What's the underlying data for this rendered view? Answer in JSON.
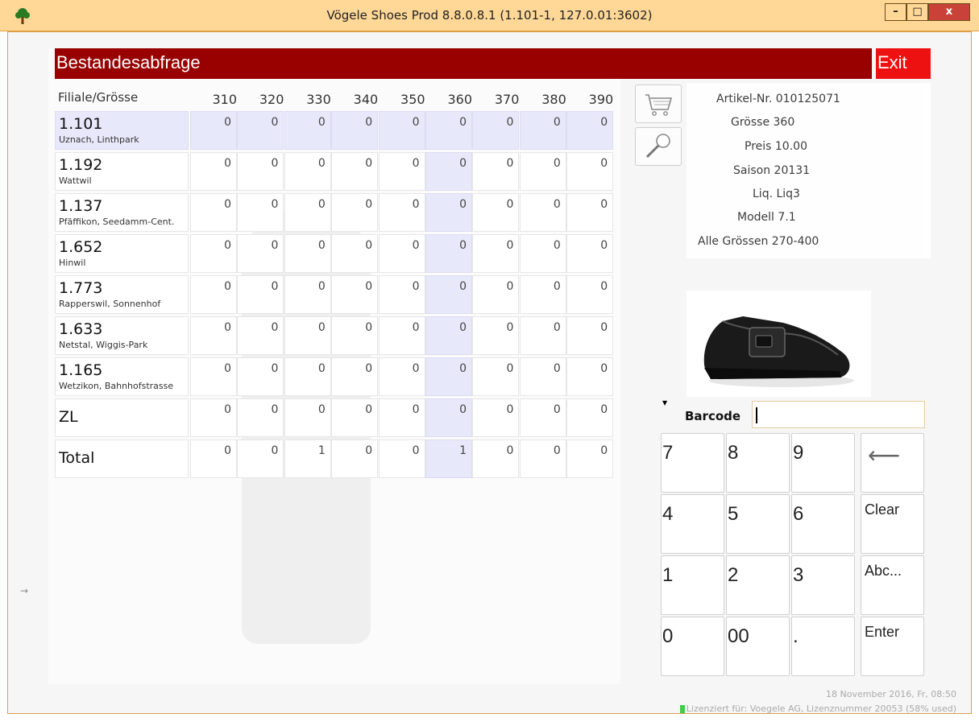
{
  "window": {
    "title": "Vögele Shoes Prod 8.8.0.8.1 (1.101-1, 127.0.01:3602)",
    "min_label": "–",
    "max_label": "□",
    "close_label": "x"
  },
  "header": {
    "title": "Bestandesabfrage",
    "exit_label": "Exit"
  },
  "grid": {
    "first_col": "Filiale/Grösse",
    "sizes": [
      "310",
      "320",
      "330",
      "340",
      "350",
      "360",
      "370",
      "380",
      "390"
    ],
    "highlight_size_index": 5,
    "rows": [
      {
        "code": "1.101",
        "name": "Uznach, Linthpark",
        "values": [
          "0",
          "0",
          "0",
          "0",
          "0",
          "0",
          "0",
          "0",
          "0"
        ],
        "highlight": true
      },
      {
        "code": "1.192",
        "name": "Wattwil",
        "values": [
          "0",
          "0",
          "0",
          "0",
          "0",
          "0",
          "0",
          "0",
          "0"
        ]
      },
      {
        "code": "1.137",
        "name": "Pfäffikon, Seedamm-Cent.",
        "values": [
          "0",
          "0",
          "0",
          "0",
          "0",
          "0",
          "0",
          "0",
          "0"
        ]
      },
      {
        "code": "1.652",
        "name": "Hinwil",
        "values": [
          "0",
          "0",
          "0",
          "0",
          "0",
          "0",
          "0",
          "0",
          "0"
        ]
      },
      {
        "code": "1.773",
        "name": "Rapperswil, Sonnenhof",
        "values": [
          "0",
          "0",
          "0",
          "0",
          "0",
          "0",
          "0",
          "0",
          "0"
        ]
      },
      {
        "code": "1.633",
        "name": "Netstal, Wiggis-Park",
        "values": [
          "0",
          "0",
          "0",
          "0",
          "0",
          "0",
          "0",
          "0",
          "0"
        ]
      },
      {
        "code": "1.165",
        "name": "Wetzikon, Bahnhofstrasse",
        "values": [
          "0",
          "0",
          "0",
          "0",
          "0",
          "0",
          "0",
          "0",
          "0"
        ]
      },
      {
        "code": "ZL",
        "name": "",
        "values": [
          "0",
          "0",
          "0",
          "0",
          "0",
          "0",
          "0",
          "0",
          "0"
        ]
      },
      {
        "code": "Total",
        "name": "",
        "values": [
          "0",
          "0",
          "1",
          "0",
          "0",
          "1",
          "0",
          "0",
          "0"
        ]
      }
    ]
  },
  "article": {
    "artikel_nr": "Artikel-Nr. 010125071",
    "groesse": "Grösse 360",
    "preis": "Preis 10.00",
    "saison": "Saison 20131",
    "liq": "Liq. Liq3",
    "modell": "Modell 7.1",
    "alle_groessen": "Alle Grössen 270-400"
  },
  "barcode": {
    "label": "Barcode",
    "value": ""
  },
  "keypad": {
    "k7": "7",
    "k8": "8",
    "k9": "9",
    "back": "⟵",
    "k4": "4",
    "k5": "5",
    "k6": "6",
    "clear": "Clear",
    "k1": "1",
    "k2": "2",
    "k3": "3",
    "abc": "Abc...",
    "k0": "0",
    "k00": "00",
    "dot": ".",
    "enter": "Enter"
  },
  "footer": {
    "date": "18 November 2016, Fr, 08:50",
    "license": "Lizenziert für: Voegele AG, Lizenznummer 20053 (58% used)"
  },
  "icons": {
    "cart": "cart-icon",
    "search": "magnifier-icon",
    "app": "tree-icon"
  },
  "colors": {
    "header_bg": "#990000",
    "exit_bg": "#ee1111",
    "titlebar_bg": "#ffd898",
    "highlight": "#e8e8fb"
  }
}
